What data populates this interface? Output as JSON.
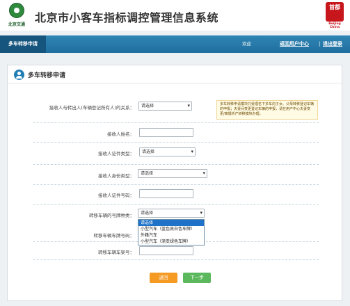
{
  "header": {
    "logo_left_text": "北京交通",
    "title": "北京市小客车指标调控管理信息系统",
    "logo_right_seal": "首都",
    "logo_right_text": "Beijing China"
  },
  "nav": {
    "current": "多车转移申请",
    "welcome": "欢迎",
    "links": [
      "返回用户中心",
      "退出登录"
    ],
    "separator": "|"
  },
  "panel": {
    "title": "多车转移申请",
    "notice": "多车转移申请模块只受理名下多车向子女、父母转移登记车辆的申报；夫妻间变更登记车辆的申报，请在用户中心夫妻变更/离婚析产转移模块办理。"
  },
  "form": {
    "relation": {
      "label": "接收人与转出人(车辆登记所有人)的关系：",
      "value": "请选择"
    },
    "name": {
      "label": "接收人姓名：",
      "value": ""
    },
    "id_type": {
      "label": "接收人证件类型：",
      "value": "请选择"
    },
    "identity_type": {
      "label": "接收人身份类型：",
      "value": "请选择"
    },
    "id_number": {
      "label": "接收人证件号码：",
      "value": ""
    },
    "plate_type": {
      "label": "转移车辆的号牌种类：",
      "value": "请选择",
      "options": [
        "请选择",
        "小型汽车（蓝色底白色车牌）",
        "外籍汽车",
        "小型汽车（渐变绿色车牌）"
      ]
    },
    "plate_number": {
      "label": "转移车辆车牌号码：",
      "value": ""
    },
    "vin": {
      "label": "转移车辆车架号：",
      "value": ""
    }
  },
  "buttons": {
    "back": "返回",
    "next": "下一步"
  },
  "colors": {
    "nav_blue": "#1f6f9f",
    "back_orange": "#f59a23",
    "next_green": "#5cb85c"
  }
}
